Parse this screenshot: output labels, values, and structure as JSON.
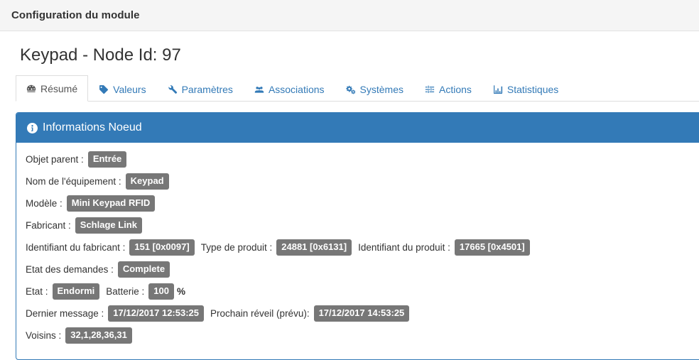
{
  "modal": {
    "title": "Configuration du module"
  },
  "page": {
    "title": "Keypad - Node Id: 97"
  },
  "tabs": [
    {
      "label": "Résumé",
      "icon": "dashboard-icon",
      "active": true
    },
    {
      "label": "Valeurs",
      "icon": "tag-icon",
      "active": false
    },
    {
      "label": "Paramètres",
      "icon": "wrench-icon",
      "active": false
    },
    {
      "label": "Associations",
      "icon": "users-icon",
      "active": false
    },
    {
      "label": "Systèmes",
      "icon": "cogs-icon",
      "active": false
    },
    {
      "label": "Actions",
      "icon": "sliders-icon",
      "active": false
    },
    {
      "label": "Statistiques",
      "icon": "bar-chart-icon",
      "active": false
    }
  ],
  "panel": {
    "icon": "info-circle-icon",
    "title": "Informations Noeud",
    "accent_color": "#337ab7",
    "badge_color": "#777777",
    "rows": [
      {
        "items": [
          {
            "type": "label",
            "text": "Objet parent :"
          },
          {
            "type": "badge",
            "text": "Entrée"
          }
        ]
      },
      {
        "items": [
          {
            "type": "label",
            "text": "Nom de l'équipement :"
          },
          {
            "type": "badge",
            "text": "Keypad"
          }
        ]
      },
      {
        "items": [
          {
            "type": "label",
            "text": "Modèle :"
          },
          {
            "type": "badge",
            "text": "Mini Keypad RFID"
          }
        ]
      },
      {
        "items": [
          {
            "type": "label",
            "text": "Fabricant :"
          },
          {
            "type": "badge",
            "text": "Schlage Link"
          }
        ]
      },
      {
        "items": [
          {
            "type": "label",
            "text": "Identifiant du fabricant :"
          },
          {
            "type": "badge",
            "text": "151 [0x0097]"
          },
          {
            "type": "label",
            "text": "Type de produit :"
          },
          {
            "type": "badge",
            "text": "24881 [0x6131]"
          },
          {
            "type": "label",
            "text": "Identifiant du produit :"
          },
          {
            "type": "badge",
            "text": "17665 [0x4501]"
          }
        ]
      },
      {
        "items": [
          {
            "type": "label",
            "text": "Etat des demandes :"
          },
          {
            "type": "badge",
            "text": "Complete"
          }
        ]
      },
      {
        "items": [
          {
            "type": "label",
            "text": "Etat :"
          },
          {
            "type": "badge",
            "text": "Endormi"
          },
          {
            "type": "label",
            "text": "Batterie :"
          },
          {
            "type": "badge",
            "text": "100"
          },
          {
            "type": "suffix",
            "text": "%"
          }
        ]
      },
      {
        "items": [
          {
            "type": "label",
            "text": "Dernier message :"
          },
          {
            "type": "badge",
            "text": "17/12/2017 12:53:25"
          },
          {
            "type": "label",
            "text": "Prochain réveil (prévu):"
          },
          {
            "type": "badge",
            "text": "17/12/2017 14:53:25"
          }
        ]
      },
      {
        "items": [
          {
            "type": "label",
            "text": "Voisins :"
          },
          {
            "type": "badge",
            "text": "32,1,28,36,31"
          }
        ]
      }
    ]
  }
}
